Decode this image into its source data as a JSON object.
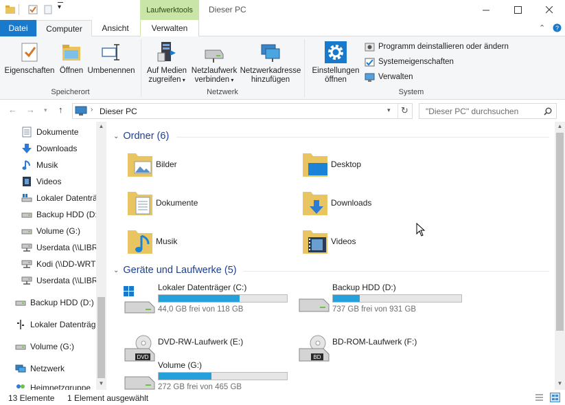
{
  "window": {
    "title": "Dieser PC",
    "context_tab_header": "Laufwerktools"
  },
  "tabs": [
    {
      "label": "Datei"
    },
    {
      "label": "Computer"
    },
    {
      "label": "Ansicht"
    },
    {
      "label": "Verwalten"
    }
  ],
  "ribbon": {
    "groups": {
      "location": "Speicherort",
      "network": "Netzwerk",
      "system": "System"
    },
    "buttons": {
      "properties": "Eigenschaften",
      "open": "Öffnen",
      "rename": "Umbenennen",
      "media_line1": "Auf Medien",
      "media_line2": "zugreifen",
      "map_drive_line1": "Netzlaufwerk",
      "map_drive_line2": "verbinden",
      "add_net_line1": "Netzwerkadresse",
      "add_net_line2": "hinzufügen",
      "settings_line1": "Einstellungen",
      "settings_line2": "öffnen"
    },
    "system_items": [
      {
        "label": "Programm deinstallieren oder ändern"
      },
      {
        "label": "Systemeigenschaften"
      },
      {
        "label": "Verwalten"
      }
    ]
  },
  "address": {
    "breadcrumb": "Dieser PC",
    "search_placeholder": "\"Dieser PC\" durchsuchen"
  },
  "nav_pane": {
    "items": [
      {
        "label": "Dokumente",
        "icon": "documents-icon"
      },
      {
        "label": "Downloads",
        "icon": "download-arrow-icon"
      },
      {
        "label": "Musik",
        "icon": "music-note-icon"
      },
      {
        "label": "Videos",
        "icon": "film-icon"
      },
      {
        "label": "Lokaler Datenträ",
        "icon": "windows-drive-icon"
      },
      {
        "label": "Backup HDD (D:",
        "icon": "drive-icon"
      },
      {
        "label": "Volume (G:)",
        "icon": "drive-icon"
      },
      {
        "label": "Userdata (\\\\LIBR",
        "icon": "network-drive-icon"
      },
      {
        "label": "Kodi (\\\\DD-WRT",
        "icon": "network-drive-icon"
      },
      {
        "label": "Userdata (\\\\LIBR",
        "icon": "network-drive-icon"
      },
      {
        "label": "Backup HDD (D:)",
        "icon": "drive-icon"
      },
      {
        "label": "Lokaler Datenträg",
        "icon": "usb-icon"
      },
      {
        "label": "Volume (G:)",
        "icon": "drive-icon"
      },
      {
        "label": "Netzwerk",
        "icon": "network-icon"
      },
      {
        "label": "Heimnetzgruppe",
        "icon": "homegroup-icon"
      }
    ]
  },
  "folders_section": {
    "title": "Ordner (6)",
    "items": [
      {
        "name": "Bilder",
        "icon": "pictures-folder-icon"
      },
      {
        "name": "Desktop",
        "icon": "desktop-folder-icon"
      },
      {
        "name": "Dokumente",
        "icon": "documents-folder-icon"
      },
      {
        "name": "Downloads",
        "icon": "downloads-folder-icon"
      },
      {
        "name": "Musik",
        "icon": "music-folder-icon"
      },
      {
        "name": "Videos",
        "icon": "videos-folder-icon"
      }
    ]
  },
  "devices_section": {
    "title": "Geräte und Laufwerke (5)",
    "items": [
      {
        "name": "Lokaler Datenträger (C:)",
        "info": "44,0 GB frei von 118 GB",
        "used_fraction": 0.63,
        "icon": "windows-drive-icon"
      },
      {
        "name": "Backup HDD (D:)",
        "info": "737 GB frei von 931 GB",
        "used_fraction": 0.21,
        "icon": "hdd-icon"
      },
      {
        "name": "DVD-RW-Laufwerk (E:)",
        "info": "",
        "icon": "dvd-drive-icon",
        "badge": "DVD"
      },
      {
        "name": "BD-ROM-Laufwerk (F:)",
        "info": "",
        "icon": "bd-drive-icon",
        "badge": "BD"
      },
      {
        "name": "Volume (G:)",
        "info": "272 GB frei von 465 GB",
        "used_fraction": 0.41,
        "icon": "hdd-icon"
      }
    ]
  },
  "status_bar": {
    "count": "13 Elemente",
    "selection": "1 Element ausgewählt"
  },
  "colors": {
    "accent": "#1979ca",
    "context_tab": "#c9e6a8",
    "progress": "#26a0da",
    "section_title": "#1e3f8f"
  }
}
